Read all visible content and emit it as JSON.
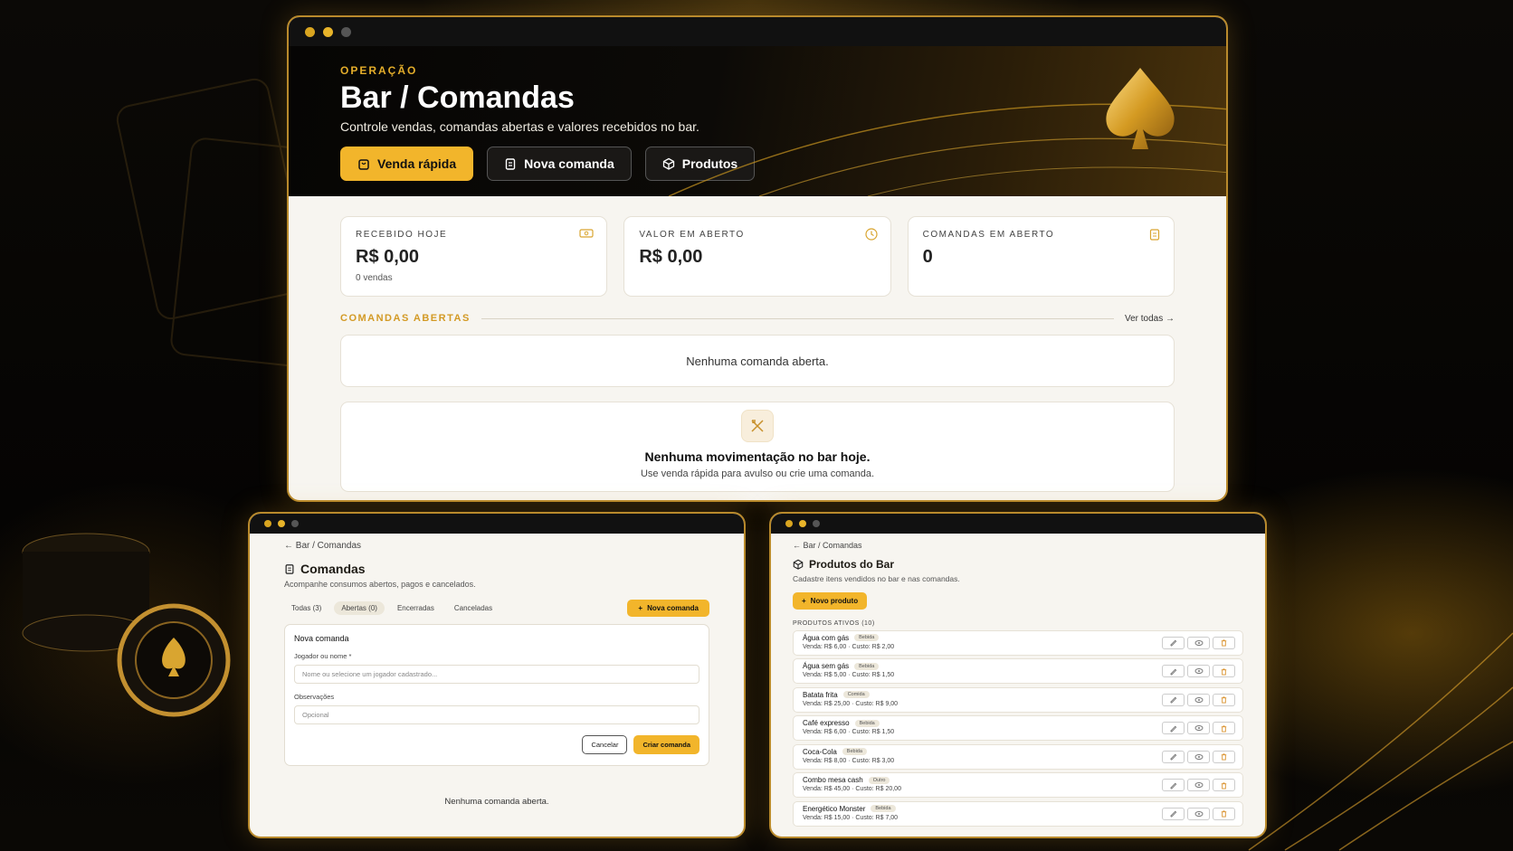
{
  "main": {
    "eyebrow": "OPERAÇÃO",
    "title": "Bar / Comandas",
    "subtitle": "Controle vendas, comandas abertas e valores recebidos no bar.",
    "buttons": [
      {
        "label": "Venda rápida",
        "icon": "bag-icon"
      },
      {
        "label": "Nova comanda",
        "icon": "clipboard-icon"
      },
      {
        "label": "Produtos",
        "icon": "box-icon"
      }
    ],
    "cards": [
      {
        "label": "RECEBIDO HOJE",
        "value": "R$ 0,00",
        "note": "0 vendas",
        "icon": "cash-icon"
      },
      {
        "label": "VALOR EM ABERTO",
        "value": "R$ 0,00",
        "icon": "clock-icon"
      },
      {
        "label": "COMANDAS EM ABERTO",
        "value": "0",
        "icon": "clipboard-icon"
      }
    ],
    "section_title": "COMANDAS ABERTAS",
    "section_link": "Ver todas →",
    "empty_open": "Nenhuma comanda aberta.",
    "empty_title": "Nenhuma movimentação no bar hoje.",
    "empty_sub": "Use venda rápida para avulso ou crie uma comanda."
  },
  "comandas": {
    "breadcrumb": "← Bar / Comandas",
    "title": "Comandas",
    "subtitle": "Acompanhe consumos abertos, pagos e cancelados.",
    "tabs": [
      "Todas (3)",
      "Abertas (0)",
      "Encerradas",
      "Canceladas"
    ],
    "new_button": "Nova comanda",
    "form": {
      "title": "Nova comanda",
      "player_label": "Jogador ou nome *",
      "player_placeholder": "Nome ou selecione um jogador cadastrado...",
      "notes_label": "Observações",
      "notes_placeholder": "Opcional",
      "cancel": "Cancelar",
      "submit": "Criar comanda"
    },
    "empty": "Nenhuma comanda aberta."
  },
  "produtos": {
    "breadcrumb": "← Bar / Comandas",
    "title": "Produtos do Bar",
    "subtitle": "Cadastre itens vendidos no bar e nas comandas.",
    "new_button": "Novo produto",
    "list_label": "PRODUTOS ATIVOS (10)",
    "items": [
      {
        "name": "Água com gás",
        "category": "Bebida",
        "info": "Venda: R$ 6,00 · Custo: R$ 2,00"
      },
      {
        "name": "Água sem gás",
        "category": "Bebida",
        "info": "Venda: R$ 5,00 · Custo: R$ 1,50"
      },
      {
        "name": "Batata frita",
        "category": "Comida",
        "info": "Venda: R$ 25,00 · Custo: R$ 9,00"
      },
      {
        "name": "Café expresso",
        "category": "Bebida",
        "info": "Venda: R$ 6,00 · Custo: R$ 1,50"
      },
      {
        "name": "Coca-Cola",
        "category": "Bebida",
        "info": "Venda: R$ 8,00 · Custo: R$ 3,00"
      },
      {
        "name": "Combo mesa cash",
        "category": "Outro",
        "info": "Venda: R$ 45,00 · Custo: R$ 20,00"
      },
      {
        "name": "Energético Monster",
        "category": "Bebida",
        "info": "Venda: R$ 15,00 · Custo: R$ 7,00"
      }
    ]
  },
  "colors": {
    "accent": "#f2b52b",
    "gold": "#d39a25",
    "dark": "#0c0a07"
  }
}
